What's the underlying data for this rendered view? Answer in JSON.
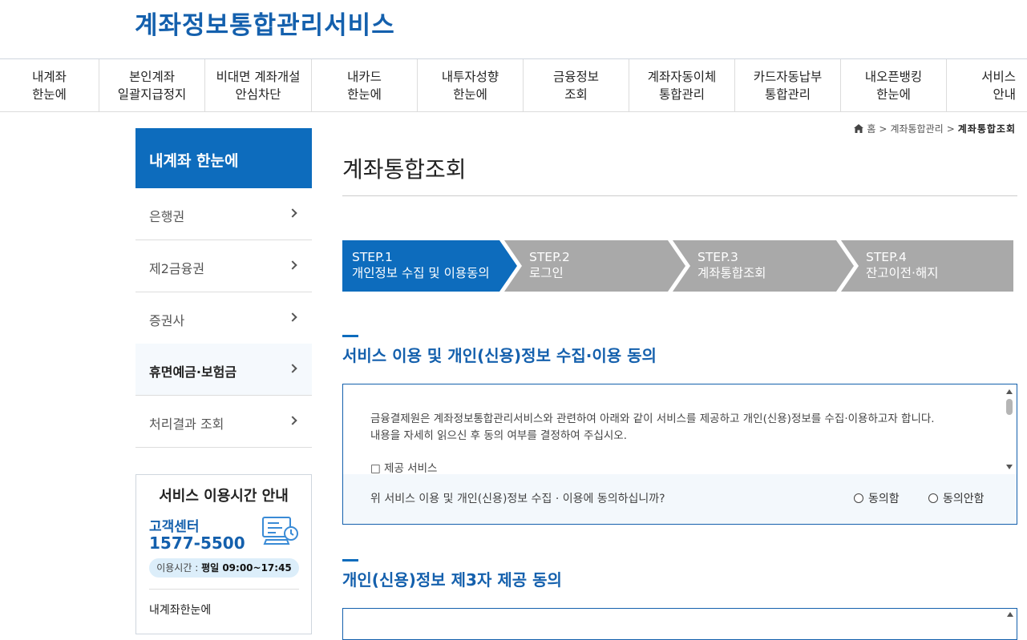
{
  "header": {
    "logo": "계좌정보통합관리서비스"
  },
  "gnb": [
    "내계좌\n한눈에",
    "본인계좌\n일괄지급정지",
    "비대면 계좌개설\n안심차단",
    "내카드\n한눈에",
    "내투자성향\n한눈에",
    "금융정보\n조회",
    "계좌자동이체\n통합관리",
    "카드자동납부\n통합관리",
    "내오픈뱅킹\n한눈에",
    "서비스\n안내"
  ],
  "lnb": {
    "title": "내계좌 한눈에",
    "items": [
      "은행권",
      "제2금융권",
      "증권사",
      "휴면예금·보험금",
      "처리결과 조회"
    ],
    "active_index": 3
  },
  "service_box": {
    "title": "서비스 이용시간 안내",
    "cs_label": "고객센터",
    "cs_phone": "1577-5500",
    "hours_label": "이용시간 : ",
    "hours_value": "평일 09:00~17:45",
    "link": "내계좌한눈에"
  },
  "breadcrumb": {
    "home": "홈",
    "parent": "계좌통합관리",
    "current": "계좌통합조회"
  },
  "page": {
    "title": "계좌통합조회"
  },
  "steps": [
    {
      "num": "STEP.1",
      "label": "개인정보 수집 및 이용동의",
      "active": true
    },
    {
      "num": "STEP.2",
      "label": "로그인",
      "active": false
    },
    {
      "num": "STEP.3",
      "label": "계좌통합조회",
      "active": false
    },
    {
      "num": "STEP.4",
      "label": "잔고이전·해지",
      "active": false
    }
  ],
  "section1": {
    "title": "서비스 이용 및 개인(신용)정보 수집·이용 동의",
    "body1": "금융결제원은 계좌정보통합관리서비스와 관련하여 아래와 같이 서비스를 제공하고 개인(신용)정보를 수집·이용하고자 합니다.",
    "body2": "내용을 자세히 읽으신 후 동의 여부를 결정하여 주십시오.",
    "body3": "□ 제공 서비스",
    "question": "위 서비스 이용 및 개인(신용)정보 수집 · 이용에 동의하십니까?",
    "agree": "동의함",
    "disagree": "동의안함"
  },
  "section2": {
    "title": "개인(신용)정보 제3자 제공 동의"
  },
  "colors": {
    "brand": "#1460ad",
    "step_active": "#0d6cbd",
    "step_inactive": "#a9a9a9"
  }
}
